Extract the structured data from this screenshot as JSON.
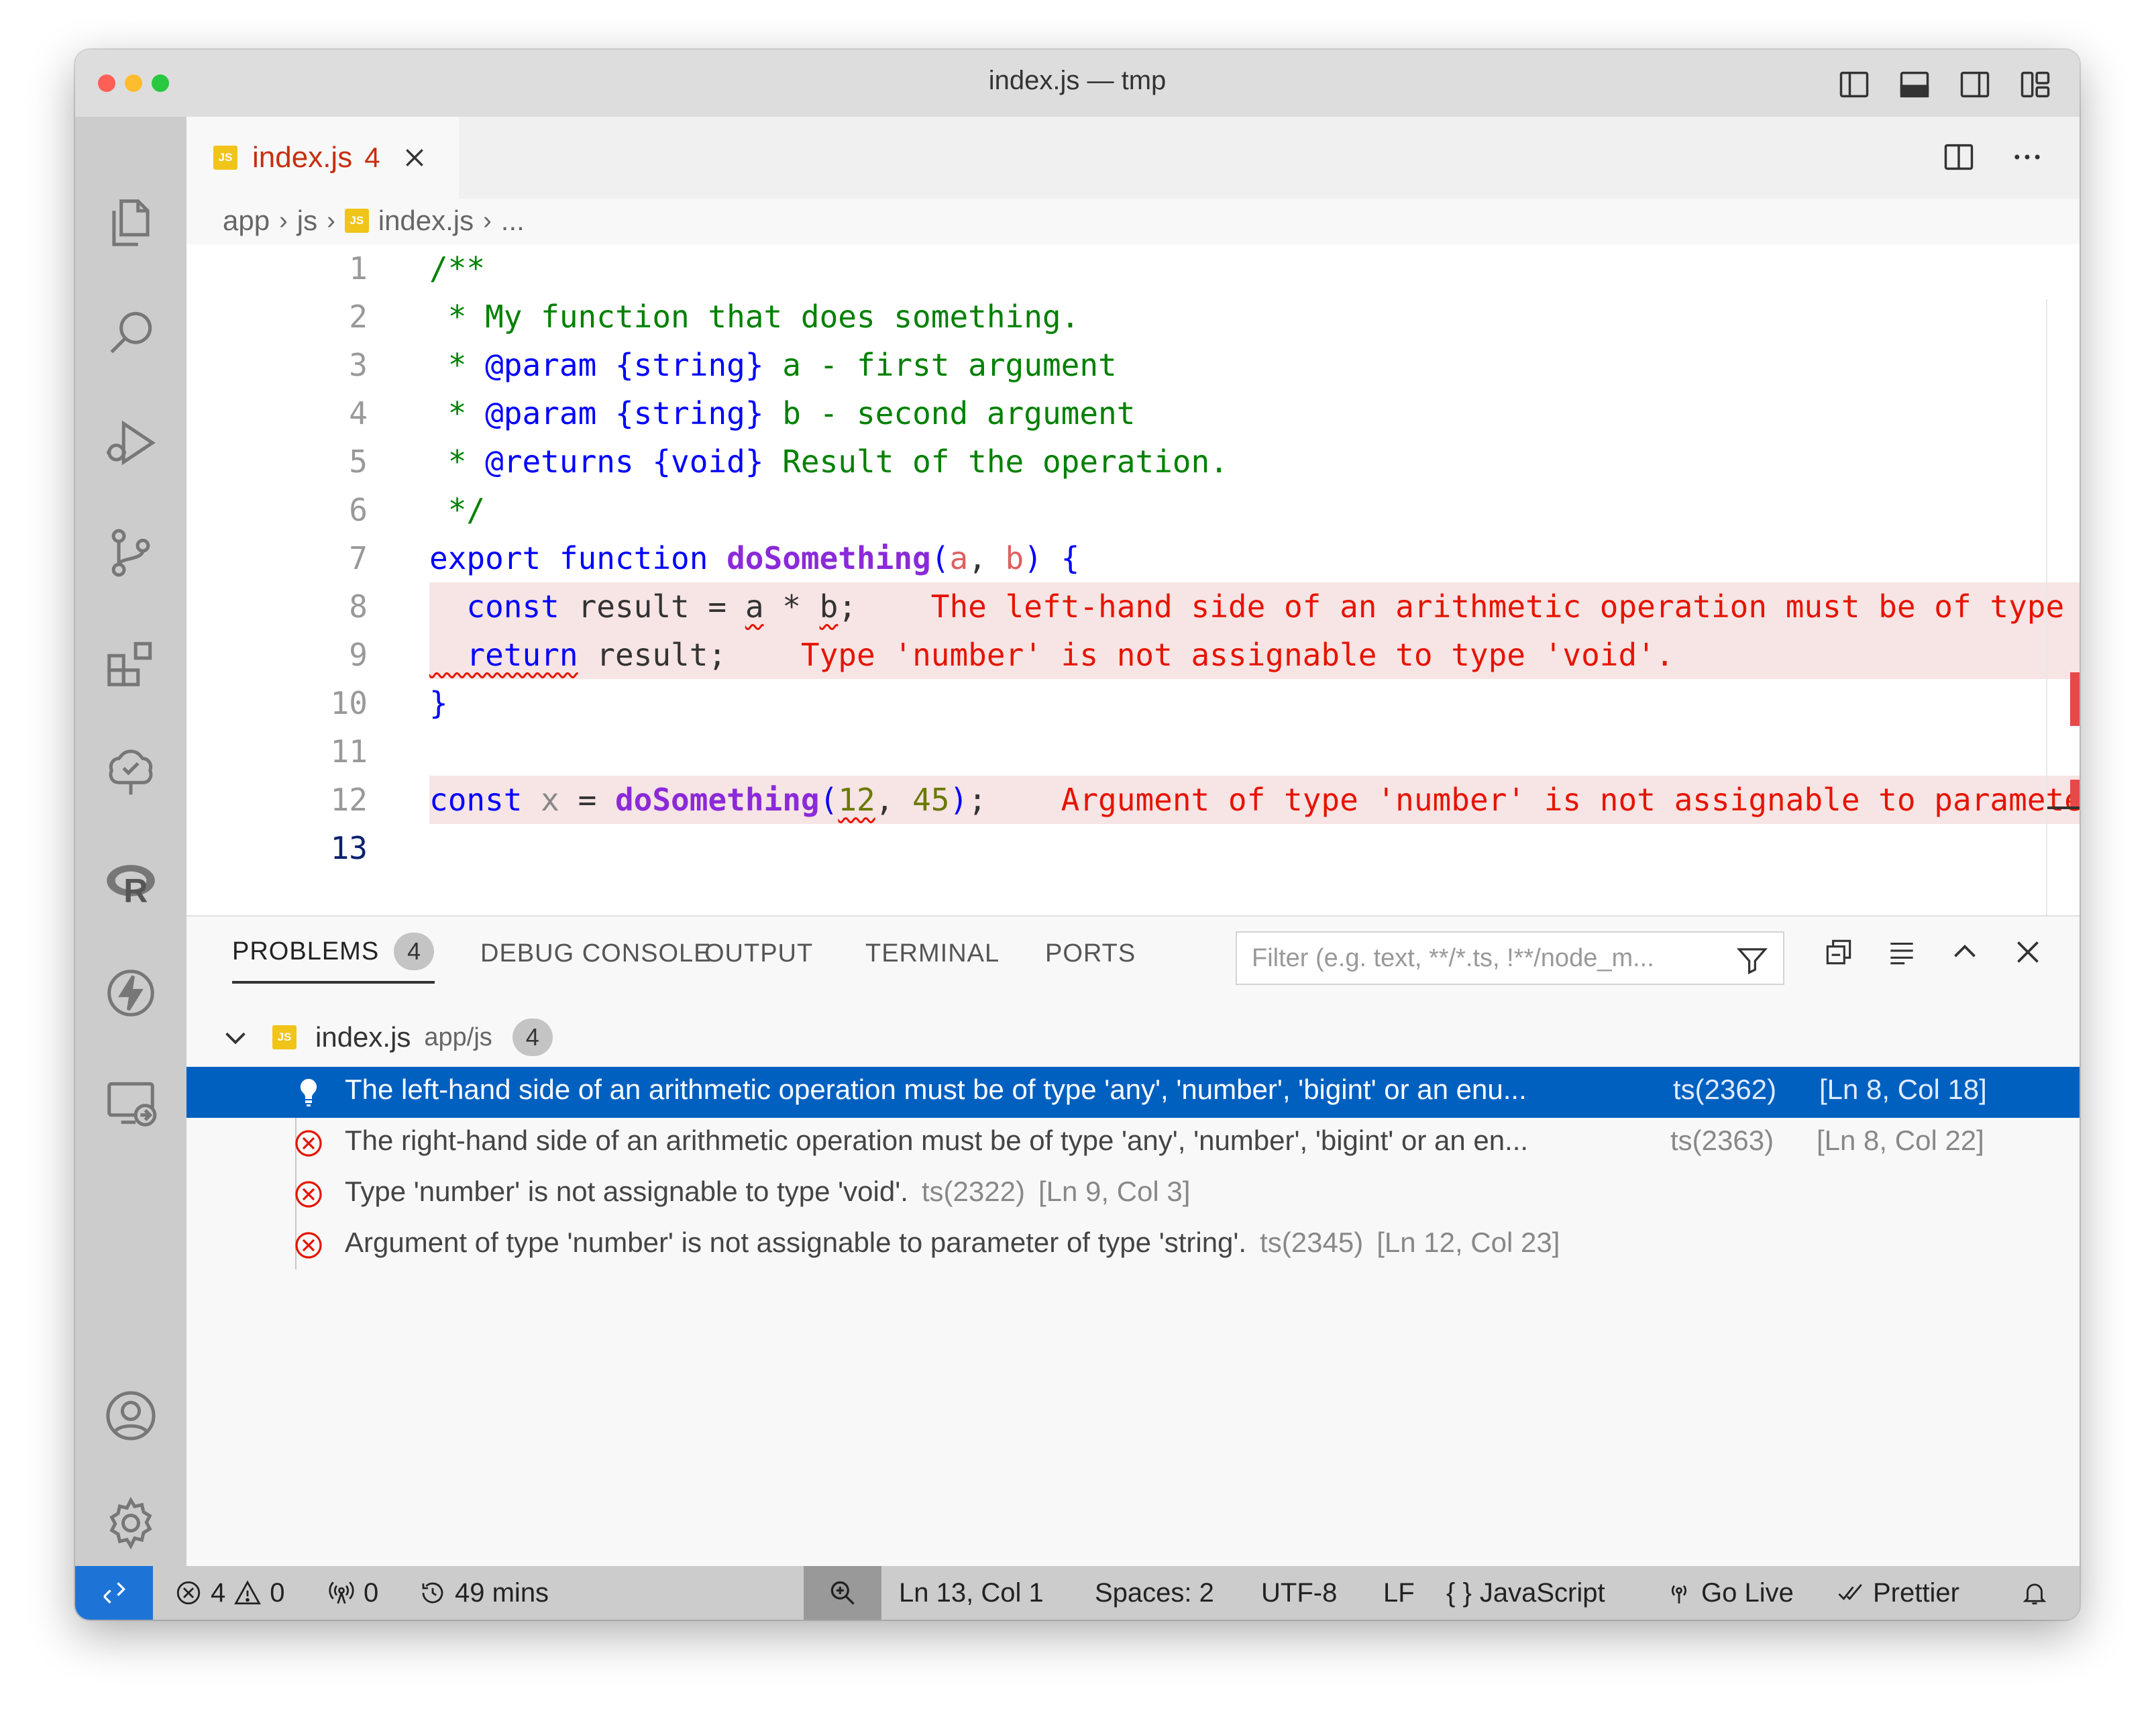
{
  "window": {
    "title": "index.js — tmp"
  },
  "activity_bar": {
    "items": [
      "explorer-icon",
      "search-icon",
      "run-debug-icon",
      "source-control-icon",
      "extensions-icon",
      "testing-icon",
      "r-icon",
      "lightning-icon",
      "remote-explorer-icon"
    ],
    "bottom": [
      "account-icon",
      "settings-gear-icon"
    ]
  },
  "tab": {
    "name": "index.js",
    "problem_count": "4",
    "badge": "JS"
  },
  "breadcrumb": {
    "items": [
      "app",
      "js",
      "index.js",
      "..."
    ]
  },
  "editor": {
    "line_numbers": [
      "1",
      "2",
      "3",
      "4",
      "5",
      "6",
      "7",
      "8",
      "9",
      "10",
      "11",
      "12",
      "13"
    ],
    "active_line": "13",
    "inline_errors": {
      "line8": "The left-hand side of an arithmetic operation must be of type",
      "line9": "Type 'number' is not assignable to type 'void'.",
      "line12": "Argument of type 'number' is not assignable to paramete"
    }
  },
  "panel": {
    "tabs": [
      "PROBLEMS",
      "DEBUG CONSOLE",
      "OUTPUT",
      "TERMINAL",
      "PORTS"
    ],
    "problems_count": "4",
    "filter_placeholder": "Filter (e.g. text, **/*.ts, !**/node_m...",
    "file": {
      "name": "index.js",
      "path": "app/js",
      "count": "4"
    },
    "problems": [
      {
        "message": "The left-hand side of an arithmetic operation must be of type 'any', 'number', 'bigint' or an enu...",
        "code": "ts(2362)",
        "location": "[Ln 8, Col 18]",
        "icon": "lightbulb-icon",
        "selected": true
      },
      {
        "message": "The right-hand side of an arithmetic operation must be of type 'any', 'number', 'bigint' or an en...",
        "code": "ts(2363)",
        "location": "[Ln 8, Col 22]",
        "icon": "error-icon",
        "selected": false
      },
      {
        "message": "Type 'number' is not assignable to type 'void'.",
        "code": "ts(2322)",
        "location": "[Ln 9, Col 3]",
        "icon": "error-icon",
        "selected": false
      },
      {
        "message": "Argument of type 'number' is not assignable to parameter of type 'string'.",
        "code": "ts(2345)",
        "location": "[Ln 12, Col 23]",
        "icon": "error-icon",
        "selected": false
      }
    ]
  },
  "statusbar": {
    "errors": "4",
    "warnings": "0",
    "ports": "0",
    "time": "49 mins",
    "cursor": "Ln 13, Col 1",
    "spaces": "Spaces: 2",
    "encoding": "UTF-8",
    "eol": "LF",
    "language": "JavaScript",
    "go_live": "Go Live",
    "prettier": "Prettier"
  },
  "colors": {
    "accent": "#0060c0",
    "error": "#e51400",
    "remote": "#1e74d6"
  }
}
